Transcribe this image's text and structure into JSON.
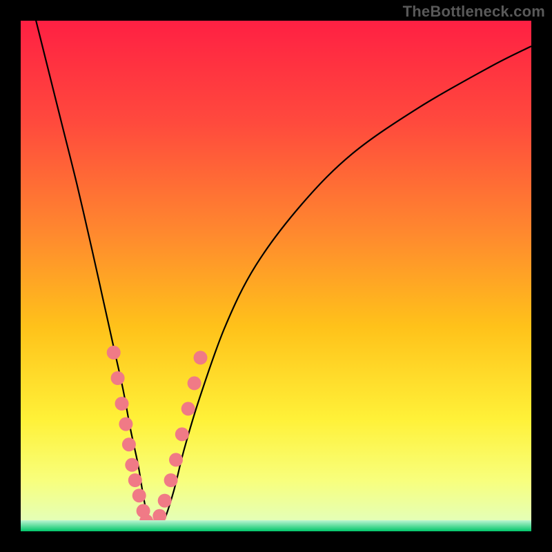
{
  "watermark": "TheBottleneck.com",
  "colors": {
    "curve_stroke": "#000000",
    "dot_fill": "#f07a86",
    "green_strip_top": "#bef5d2",
    "green_strip_bottom": "#00c56a"
  },
  "gradient_stops": [
    {
      "offset": 0,
      "color": "#ff2043"
    },
    {
      "offset": 20,
      "color": "#ff4a3d"
    },
    {
      "offset": 42,
      "color": "#ff8a2e"
    },
    {
      "offset": 60,
      "color": "#ffc21a"
    },
    {
      "offset": 78,
      "color": "#fff138"
    },
    {
      "offset": 90,
      "color": "#f8ff7c"
    },
    {
      "offset": 98,
      "color": "#e4ffb8"
    },
    {
      "offset": 100,
      "color": "#9fffc6"
    }
  ],
  "chart_data": {
    "type": "line",
    "title": "",
    "xlabel": "",
    "ylabel": "",
    "xlim": [
      0,
      100
    ],
    "ylim": [
      0,
      100
    ],
    "series": [
      {
        "name": "bottleneck-curve",
        "x": [
          2,
          5,
          8,
          11,
          14,
          16,
          18,
          20,
          21.5,
          23,
          24,
          25,
          26,
          28,
          30,
          32,
          35,
          40,
          46,
          55,
          65,
          78,
          92,
          100
        ],
        "values": [
          104,
          92,
          80,
          68,
          55,
          46,
          37,
          28,
          20,
          13,
          7,
          2,
          0,
          2,
          8,
          16,
          26,
          40,
          52,
          64,
          74,
          83,
          91,
          95
        ]
      }
    ],
    "dot_points": {
      "x": [
        18.2,
        19.0,
        19.8,
        20.6,
        21.2,
        21.8,
        22.4,
        23.2,
        24.0,
        24.6,
        25.4,
        26.4,
        27.2,
        28.2,
        29.4,
        30.4,
        31.6,
        32.8,
        34.0,
        35.2
      ],
      "values": [
        35,
        30,
        25,
        21,
        17,
        13,
        10,
        7,
        4,
        2,
        1,
        1,
        3,
        6,
        10,
        14,
        19,
        24,
        29,
        34
      ]
    },
    "green_band_y": [
      0,
      2
    ]
  }
}
